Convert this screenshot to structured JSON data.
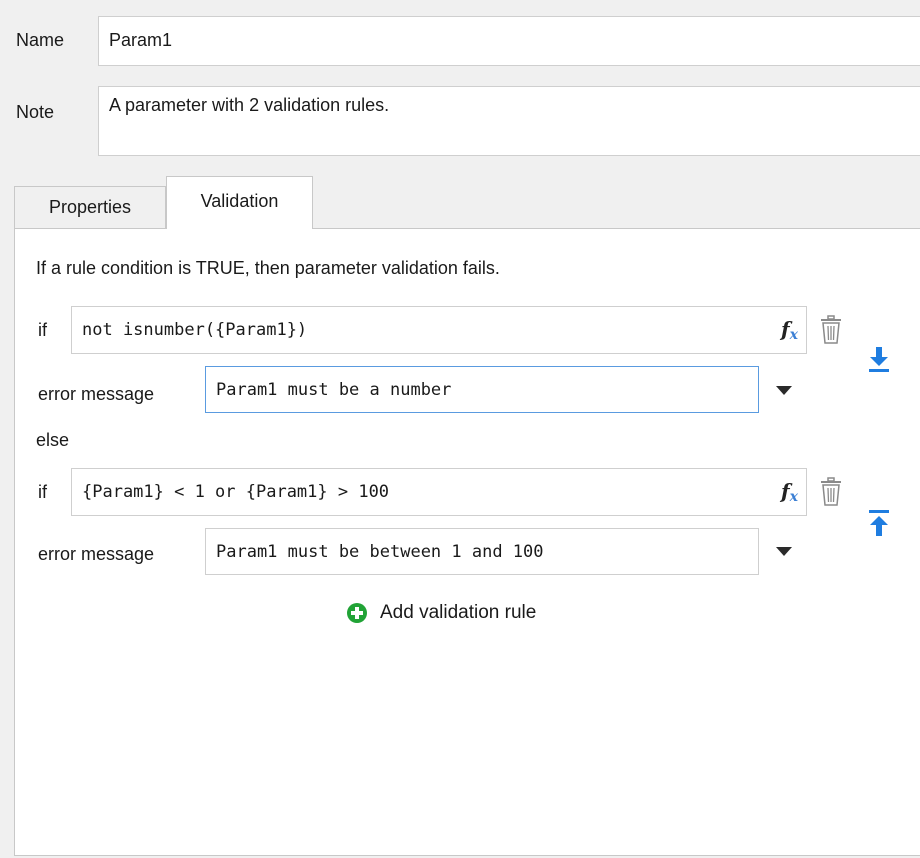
{
  "header": {
    "name_label": "Name",
    "name_value": "Param1",
    "note_label": "Note",
    "note_value": "A parameter with 2 validation rules."
  },
  "tabs": [
    {
      "label": "Properties",
      "active": false
    },
    {
      "label": "Validation",
      "active": true
    }
  ],
  "validation": {
    "description": "If a rule condition is TRUE, then parameter validation fails.",
    "else_label": "else",
    "rules": [
      {
        "if_label": "if",
        "condition": "not isnumber({Param1})",
        "error_label": "error message",
        "error_message": "Param1 must be a number",
        "fx_main": "f",
        "fx_sub": "x",
        "move_icon": "arrow-down-to-line-icon"
      },
      {
        "if_label": "if",
        "condition": "{Param1} < 1 or {Param1} > 100",
        "error_label": "error message",
        "error_message": "Param1 must be between 1 and 100",
        "fx_main": "f",
        "fx_sub": "x",
        "move_icon": "arrow-up-to-line-icon"
      }
    ],
    "add_rule_label": "Add validation rule"
  },
  "colors": {
    "accent_blue": "#1f7de0",
    "add_green": "#21a336",
    "focus_border": "#5a9be0"
  }
}
